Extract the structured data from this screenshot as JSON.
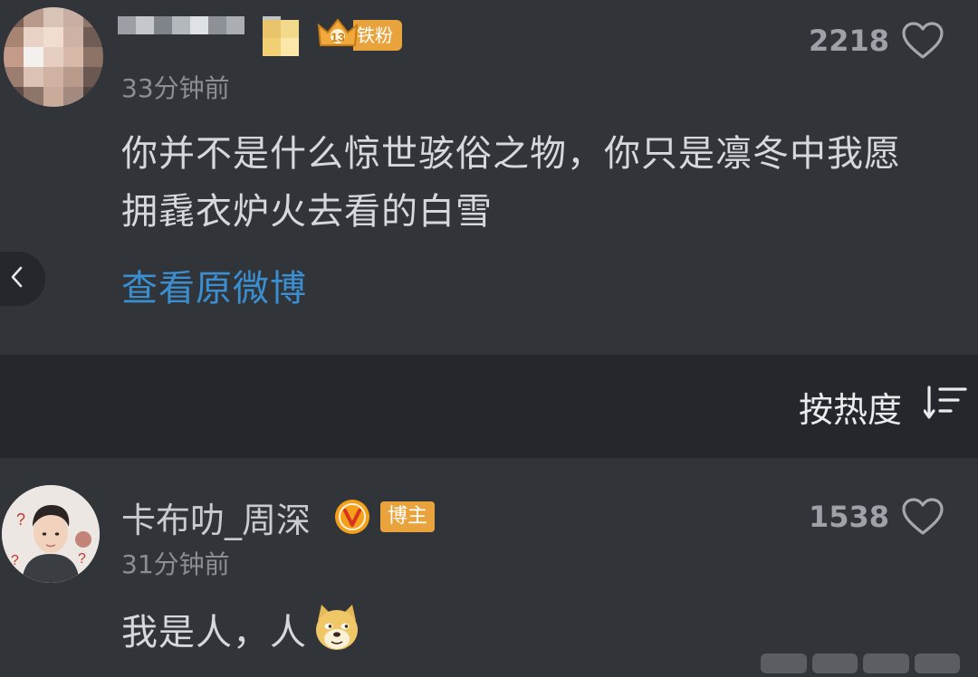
{
  "comments": [
    {
      "badge_label": "铁粉",
      "time": "33分钟前",
      "like_count": "2218",
      "text_line1": "你并不是什么惊世骇俗之物，你只是凛冬中我愿",
      "text_line2": "拥毳衣炉火去看的白雪",
      "view_original": "查看原微博"
    },
    {
      "username": "卡布叻_周深",
      "owner_badge": "博主",
      "time": "31分钟前",
      "like_count": "1538",
      "text": "我是人，人"
    }
  ],
  "sort": {
    "label": "按热度"
  },
  "icons": {
    "back": "chevron-left-icon",
    "like": "heart-outline-icon",
    "sort": "sort-descending-icon",
    "verified": "verified-v-icon",
    "emoji": "doge-emoji"
  },
  "colors": {
    "background": "#31353a",
    "sort_bar": "#24272b",
    "link": "#3b8fd0",
    "badge": "#e8a33c"
  }
}
